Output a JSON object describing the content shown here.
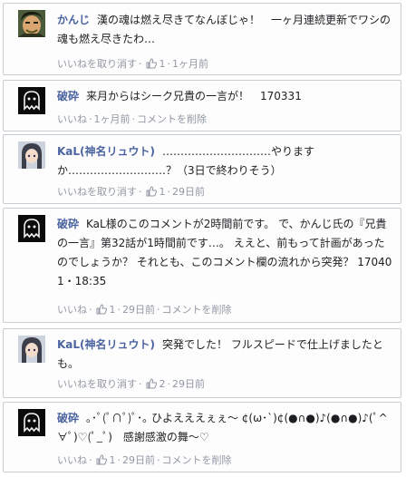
{
  "comments": [
    {
      "author": "かんじ",
      "avatar_icon": "user-photo-avatar-icon",
      "text": "漢の魂は燃え尽きてなんぼじゃ！　一ヶ月連続更新でワシの魂も燃え尽きたわ…",
      "actions": {
        "like": "いいねを取り消す",
        "like_count": "1",
        "time": "1ヶ月前"
      }
    },
    {
      "author": "破砕",
      "avatar_icon": "ghost-avatar-icon",
      "text": "来月からはシーク兄貴の一言が！　170331",
      "actions": {
        "like": "いいね",
        "time": "1ヶ月前",
        "delete": "コメントを削除"
      }
    },
    {
      "author": "KaL(神名リュウト)",
      "avatar_icon": "anime-avatar-icon",
      "text": "…………………………やりますか………………………？（3日で終わりそう）",
      "actions": {
        "like": "いいねを取り消す",
        "like_count": "1",
        "time": "29日前"
      }
    },
    {
      "author": "破砕",
      "avatar_icon": "ghost-avatar-icon",
      "text": "KaL様のこのコメントが2時間前です。 で、かんじ氏の『兄貴の一言』第32話が1時間前です…。 ええと、前もって計画があったのでしょうか？ それとも、このコメント欄の流れから突発？ 170401・18:35",
      "actions": {
        "like": "いいね",
        "like_count": "1",
        "time": "29日前",
        "delete": "コメントを削除"
      }
    },
    {
      "author": "KaL(神名リュウト)",
      "avatar_icon": "anime-avatar-icon",
      "text": "突発でした！ フルスピードで仕上げましたとも。",
      "actions": {
        "like": "いいねを取り消す",
        "like_count": "2",
        "time": "29日前"
      }
    },
    {
      "author": "破砕",
      "avatar_icon": "ghost-avatar-icon",
      "text": "｡･ﾟ(ﾟ∩ﾟ)ﾟ･｡ ひよえええぇぇ〜 ¢(ω･`)¢(●∩●)♪(●∩●)♪(ﾟ^∀ﾟ)♡(ﾟ_ﾟ)　感謝感激の舞〜♡",
      "actions": {
        "like": "いいね",
        "like_count": "1",
        "time": "29日前",
        "delete": "コメントを削除"
      }
    }
  ]
}
